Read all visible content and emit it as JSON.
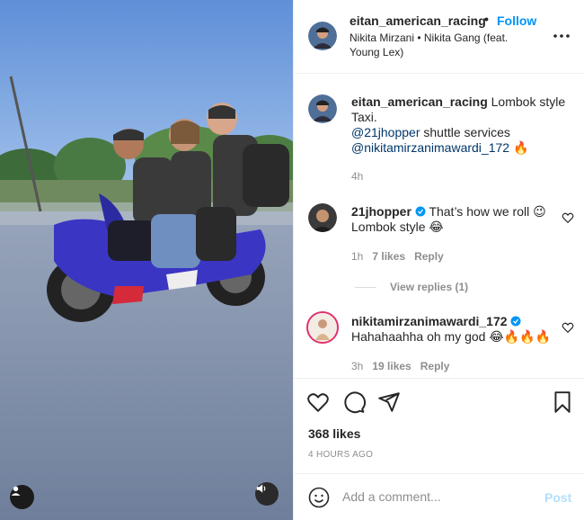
{
  "header": {
    "username": "eitan_american_racing",
    "separator": "•",
    "follow_label": "Follow",
    "audio": "Nikita Mirzani • Nikita Gang (feat. Young Lex)"
  },
  "caption": {
    "username": "eitan_american_racing",
    "text_1": "Lombok style Taxi.",
    "mention_1": "@21jhopper",
    "text_2": "shuttle services",
    "mention_2": "@nikitamirzanimawardi_172",
    "emoji": "🔥",
    "time": "4h"
  },
  "comments": [
    {
      "username": "21jhopper",
      "text": "That’s how we roll 😉Lombok style 😂",
      "time": "1h",
      "likes": "7 likes",
      "reply_label": "Reply",
      "view_replies": "View replies (1)"
    },
    {
      "username": "nikitamirzanimawardi_172",
      "text": "Hahahaahha oh my god 😂🔥🔥🔥",
      "time": "3h",
      "likes": "19 likes",
      "reply_label": "Reply"
    }
  ],
  "actions": {
    "likes": "368 likes",
    "time_ago": "4 HOURS AGO"
  },
  "add_comment": {
    "placeholder": "Add a comment...",
    "post_label": "Post"
  },
  "colors": {
    "accent": "#0095f6",
    "verified": "#0095f6",
    "scooter": "#3b35c4",
    "sky": "#7eb0e8"
  },
  "icons": [
    "more-icon",
    "verified-icon",
    "heart-icon",
    "comment-icon",
    "share-icon",
    "bookmark-icon",
    "emoji-icon",
    "user-tag-icon",
    "audio-icon"
  ]
}
